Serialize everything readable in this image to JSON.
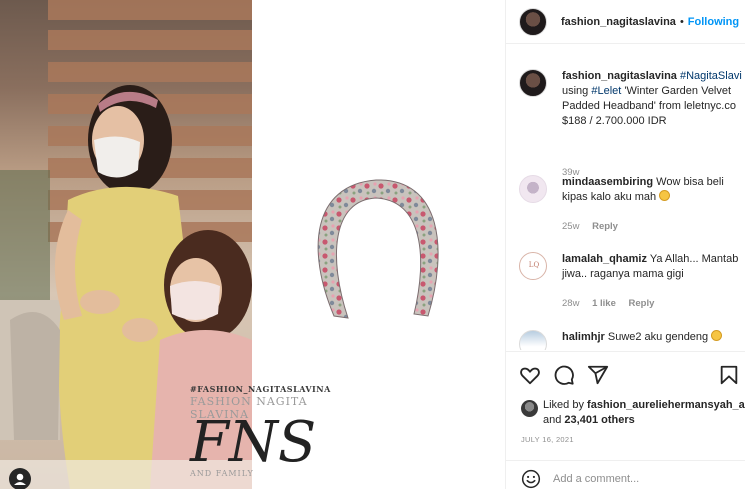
{
  "post": {
    "watermark": {
      "line1": "#FASHION_NAGITASLAVINA",
      "line2": "FASHION NAGITA SLAVINA",
      "big": "FNS",
      "line3": "AND FAMILY"
    }
  },
  "header": {
    "username": "fashion_nagitaslavina",
    "separator": "•",
    "follow_label": "Following"
  },
  "caption": {
    "username": "fashion_nagitaslavina",
    "hashtag1": "#NagitaSlavi",
    "text1": "using",
    "hashtag2": "#Lelet",
    "text2": "'Winter Garden Velvet",
    "line3": "Padded Headband' from leletnyc.co",
    "line4": "$188 / 2.700.000 IDR",
    "time": "39w"
  },
  "comments": [
    {
      "username": "mindaasembiring",
      "line1": "Wow bisa beli",
      "line2": "kipas kalo aku mah",
      "time": "25w",
      "likes": "",
      "reply": "Reply"
    },
    {
      "username": "lamalah_qhamiz",
      "line1": "Ya Allah... Mantab",
      "line2": "jiwa.. raganya mama gigi",
      "time": "28w",
      "likes": "1 like",
      "reply": "Reply",
      "avatar_text": "LQ"
    },
    {
      "username": "halimhjr",
      "line1": "Suwe2 aku gendeng"
    }
  ],
  "likes": {
    "prefix": "Liked by",
    "user": "fashion_aureliehermansyah_a",
    "and": "and",
    "count": "23,401 others"
  },
  "date": "JULY 16, 2021",
  "add_comment": {
    "placeholder": "Add a comment..."
  },
  "icons": [
    "heart-icon",
    "comment-icon",
    "share-icon",
    "bookmark-icon",
    "emoji-icon",
    "user-tag-icon"
  ],
  "colors": {
    "accent": "#0095f6",
    "link": "#00376b",
    "muted": "#8e8e8e"
  }
}
